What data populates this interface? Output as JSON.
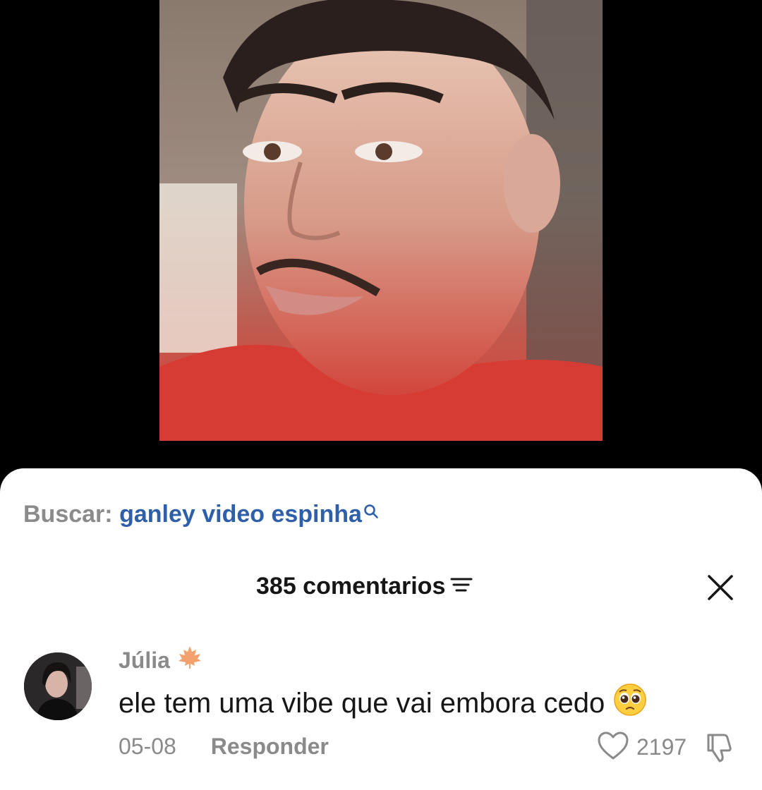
{
  "search": {
    "prefix": "Buscar:",
    "query": "ganley video espinha"
  },
  "comments_header": {
    "count_label": "385 comentarios"
  },
  "comment": {
    "username": "Júlia",
    "text": "ele tem uma vibe que vai embora cedo",
    "date": "05-08",
    "reply_label": "Responder",
    "likes": "2197"
  },
  "icons": {
    "search": "search-icon",
    "filter": "filter-icon",
    "close": "close-icon",
    "leaf": "maple-leaf-icon",
    "emoji": "pleading-face-emoji",
    "like": "heart-icon",
    "dislike": "thumbs-down-icon"
  },
  "colors": {
    "query_link": "#2e5fa8",
    "muted_text": "#8a8a8a",
    "primary_text": "#161616"
  }
}
